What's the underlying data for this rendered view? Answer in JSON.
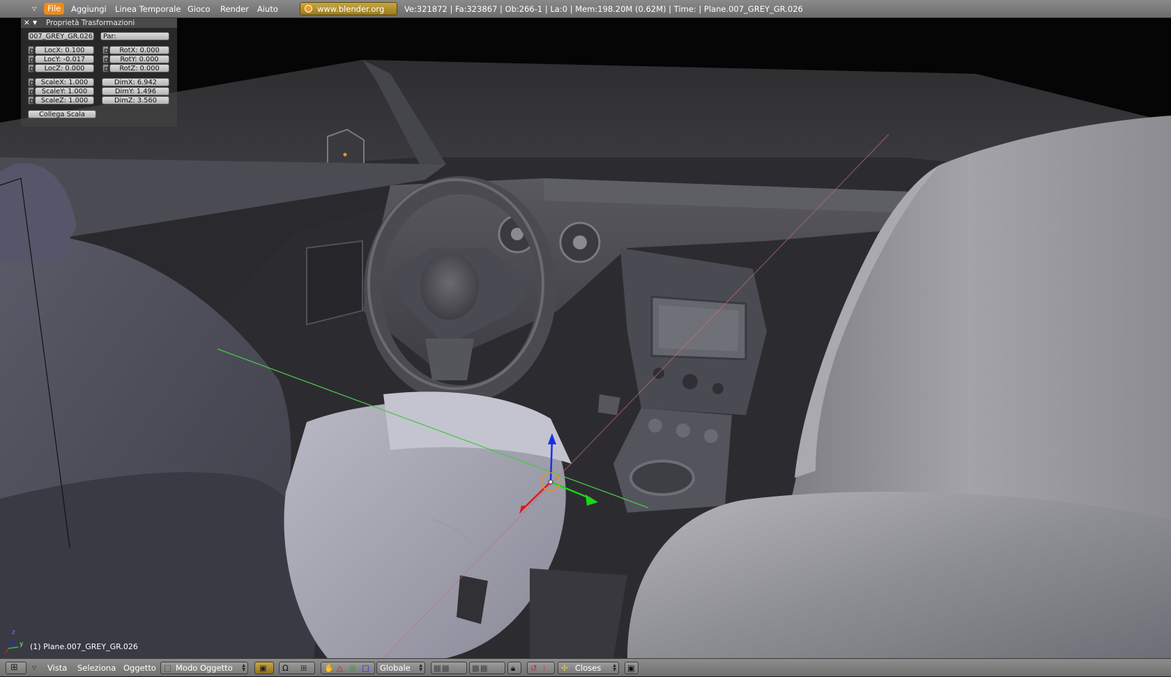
{
  "topbar": {
    "menus": [
      "File",
      "Aggiungi",
      "Linea Temporale",
      "Gioco",
      "Render",
      "Aiuto"
    ],
    "url": "www.blender.org 248",
    "stats": "Ve:321872 | Fa:323867 | Ob:266-1 | La:0 | Mem:198.20M (0.62M) | Time: | Plane.007_GREY_GR.026"
  },
  "panel": {
    "title": "Proprietà Trasformazioni",
    "object_name": "007_GREY_GR.026",
    "parent_placeholder": "Par:",
    "loc": [
      "LocX: 0.100",
      "LocY: -0.017",
      "LocZ: 0.000"
    ],
    "rot": [
      "RotX: 0.000",
      "RotY: 0.000",
      "RotZ: 0.000"
    ],
    "scale": [
      "ScaleX: 1.000",
      "ScaleY: 1.000",
      "ScaleZ: 1.000"
    ],
    "dim": [
      "DimX: 6.942",
      "DimY: 1.496",
      "DimZ: 3.560"
    ],
    "link_scale": "Collega Scala"
  },
  "viewport": {
    "object_label": "(1) Plane.007_GREY_GR.026",
    "axes": [
      "z",
      "y"
    ]
  },
  "bottombar": {
    "menus": [
      "Vista",
      "Seleziona",
      "Oggetto"
    ],
    "mode": "Modo Oggetto",
    "orientation": "Globale",
    "snap_target": "Closes"
  },
  "colors": {
    "menu_active": "#f08a1a",
    "url_box": "#b8962e",
    "axis_x": "#e01818",
    "axis_y": "#18d818",
    "axis_z": "#1a2ee8",
    "manipulator": "#f0901e"
  }
}
